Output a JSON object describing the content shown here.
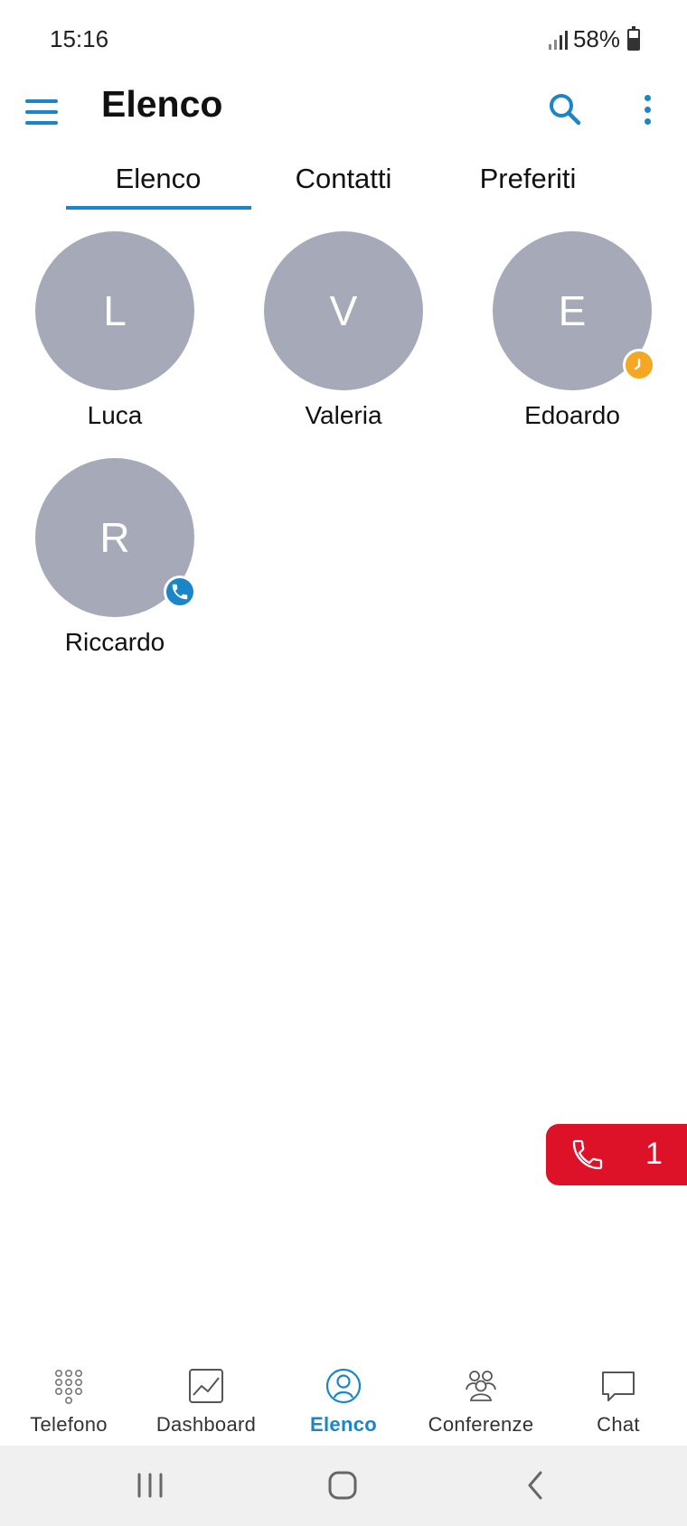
{
  "status_bar": {
    "time": "15:16",
    "battery": "58%",
    "battery_level": 0.58
  },
  "app_bar": {
    "title": "Elenco"
  },
  "tabs": [
    {
      "label": "Elenco",
      "active": true
    },
    {
      "label": "Contatti",
      "active": false
    },
    {
      "label": "Preferiti",
      "active": false
    }
  ],
  "contacts": [
    {
      "initial": "L",
      "name": "Luca",
      "status": "none"
    },
    {
      "initial": "V",
      "name": "Valeria",
      "status": "none"
    },
    {
      "initial": "E",
      "name": "Edoardo",
      "status": "away"
    },
    {
      "initial": "R",
      "name": "Riccardo",
      "status": "on-call"
    }
  ],
  "active_calls": {
    "count": "1"
  },
  "bottom_nav": [
    {
      "label": "Telefono",
      "icon": "dialpad-icon",
      "active": false
    },
    {
      "label": "Dashboard",
      "icon": "chart-icon",
      "active": false
    },
    {
      "label": "Elenco",
      "icon": "contact-icon",
      "active": true
    },
    {
      "label": "Conferenze",
      "icon": "group-icon",
      "active": false
    },
    {
      "label": "Chat",
      "icon": "chat-icon",
      "active": false
    }
  ],
  "colors": {
    "accent": "#1a86c8",
    "avatar": "#a5a9b8",
    "call_pill": "#dd1128",
    "away": "#f5a623"
  }
}
